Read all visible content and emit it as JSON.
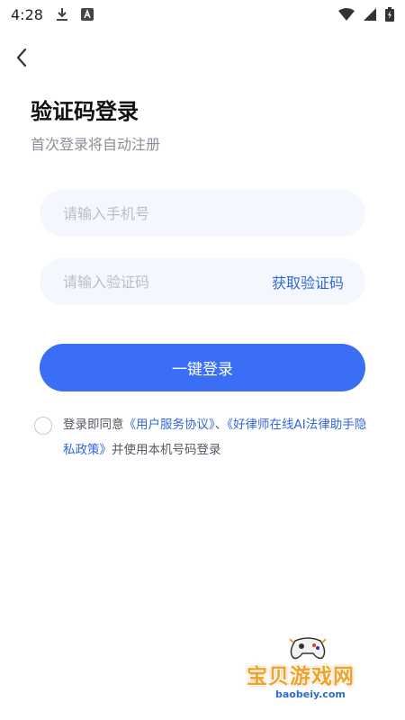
{
  "status_bar": {
    "time": "4:28",
    "icons": [
      "download-icon",
      "a-badge-icon",
      "wifi-icon",
      "signal-icon",
      "battery-charging-icon"
    ]
  },
  "nav": {
    "back_icon": "chevron-left-icon"
  },
  "header": {
    "title": "验证码登录",
    "subtitle": "首次登录将自动注册"
  },
  "form": {
    "phone_placeholder": "请输入手机号",
    "phone_value": "",
    "code_placeholder": "请输入验证码",
    "code_value": "",
    "get_code_label": "获取验证码",
    "login_label": "一键登录"
  },
  "agreement": {
    "checked": false,
    "prefix": "登录即同意",
    "user_agreement": "《用户服务协议》",
    "separator": "、",
    "privacy_policy": "《好律师在线AI法律助手隐私政策》",
    "suffix": "并使用本机号码登录"
  },
  "watermark": {
    "text": "宝贝游戏网",
    "url": "baobeiy.com"
  },
  "colors": {
    "primary": "#3a6ef5",
    "link": "#3068d8",
    "input_bg": "#f4f7fd",
    "watermark": "#f0a22a"
  }
}
